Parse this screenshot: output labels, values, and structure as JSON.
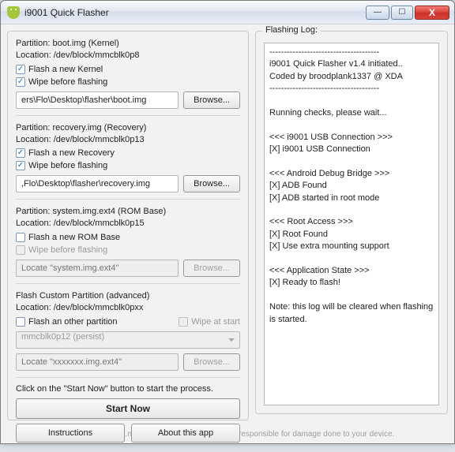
{
  "window": {
    "title": "i9001 Quick Flasher"
  },
  "kernel": {
    "header1": "Partition: boot.img (Kernel)",
    "header2": "Location: /dev/block/mmcblk0p8",
    "flash_label": "Flash a new Kernel",
    "wipe_label": "Wipe before flashing",
    "path_value": "ers\\Flo\\Desktop\\flasher\\boot.img",
    "browse": "Browse..."
  },
  "recovery": {
    "header1": "Partition: recovery.img (Recovery)",
    "header2": "Location: /dev/block/mmcblk0p13",
    "flash_label": "Flash a new Recovery",
    "wipe_label": "Wipe before flashing",
    "path_value": ",Flo\\Desktop\\flasher\\recovery.img",
    "browse": "Browse..."
  },
  "system": {
    "header1": "Partition: system.img.ext4 (ROM Base)",
    "header2": "Location: /dev/block/mmcblk0p15",
    "flash_label": "Flash a new ROM Base",
    "wipe_label": "Wipe before flashing",
    "path_placeholder": "Locate \"system.img.ext4\"",
    "browse": "Browse..."
  },
  "custom": {
    "header1": "Flash Custom Partition (advanced)",
    "header2": "Location: /dev/block/mmcblk0pxx",
    "flash_label": "Flash an other partition",
    "wipe_label": "Wipe at start",
    "combo_value": "mmcblk0p12 (persist)",
    "path_placeholder": "Locate \"xxxxxxx.img.ext4\"",
    "browse": "Browse..."
  },
  "actions": {
    "hint": "Click on the \"Start Now\" button to start the process.",
    "start": "Start Now",
    "instructions": "Instructions",
    "about": "About this app"
  },
  "log": {
    "title": "Flashing Log:",
    "content": "--------------------------------------\ni9001 Quick Flasher v1.4 initiated..\nCoded by broodplank1337 @ XDA\n--------------------------------------\n\nRunning checks, please wait...\n\n<<< i9001 USB Connection >>>\n[X] i9001 USB Connection\n\n<<< Android Debug Bridge >>>\n[X] ADB Found\n[X] ADB started in root mode\n\n<<< Root Access >>>\n[X] Root Found\n[X] Use extra mounting support\n\n<<< Application State >>>\n[X] Ready to flash!\n\nNote: this log will be cleared when flashing is started."
  },
  "footer": {
    "text": "©2012 broodplank.net - Use with caution! I am not responsible for damage done to your device."
  }
}
